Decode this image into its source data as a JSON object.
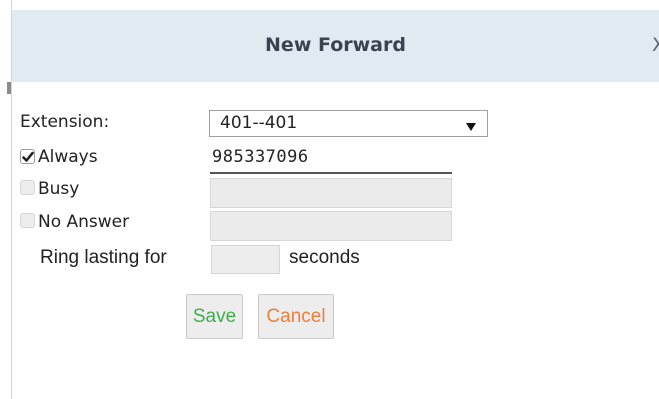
{
  "dialog": {
    "title": "New Forward",
    "close_label": "X"
  },
  "form": {
    "extension_label": "Extension:",
    "extension_value": "401--401",
    "always": {
      "label": "Always",
      "checked": true,
      "value": "985337096"
    },
    "busy": {
      "label": "Busy",
      "checked": false,
      "value": ""
    },
    "no_answer": {
      "label": "No Answer",
      "checked": false,
      "value": ""
    },
    "ring_label": "Ring lasting for",
    "ring_value": "",
    "seconds_label": "seconds"
  },
  "buttons": {
    "save": "Save",
    "cancel": "Cancel"
  },
  "colors": {
    "titlebar": "#e2eaf1",
    "save_text": "#3fae49",
    "cancel_text": "#ef7e3c"
  }
}
